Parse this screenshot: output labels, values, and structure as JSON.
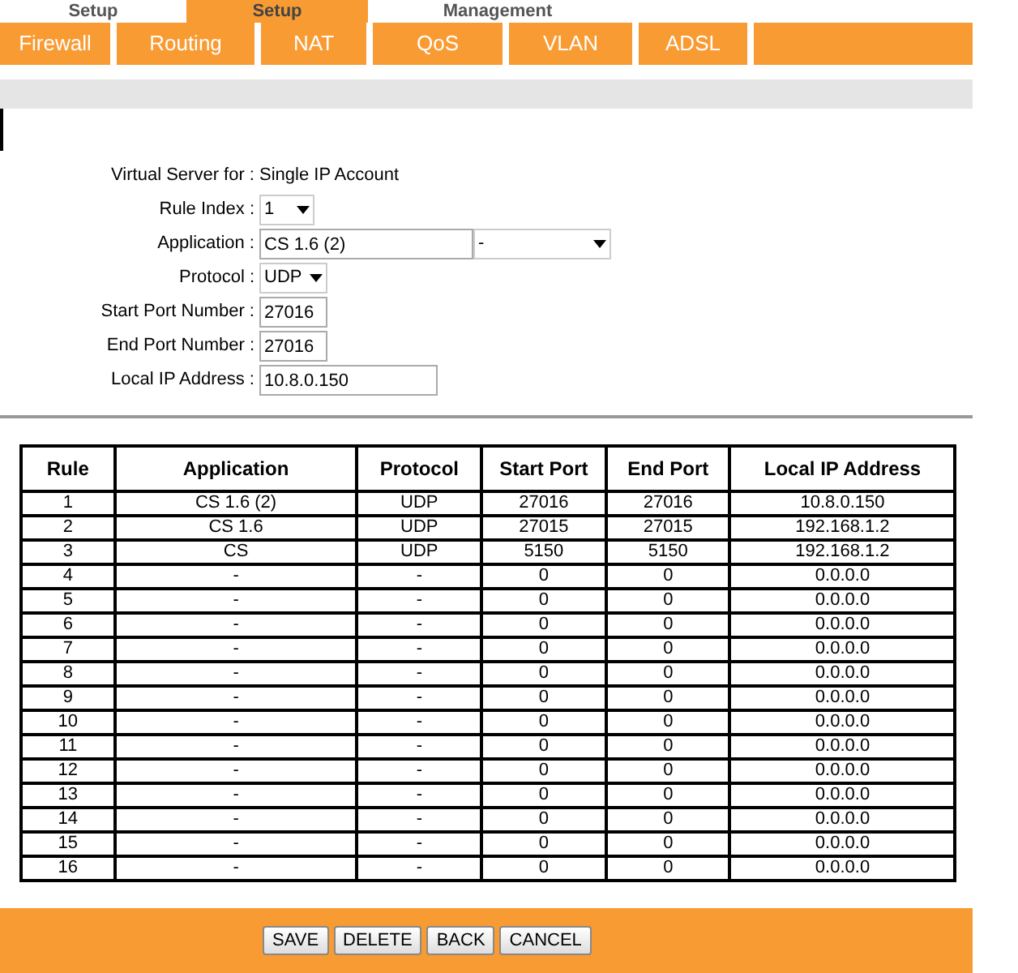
{
  "top_tabs": [
    {
      "label": "Setup",
      "selected": false
    },
    {
      "label": "Setup",
      "selected": true
    },
    {
      "label": "Management",
      "selected": false
    }
  ],
  "sub_tabs": [
    "Firewall",
    "Routing",
    "NAT",
    "QoS",
    "VLAN",
    "ADSL"
  ],
  "form": {
    "virtual_server_label": "Virtual Server for :",
    "virtual_server_value": "Single IP Account",
    "rule_index_label": "Rule Index :",
    "rule_index": "1",
    "application_label": "Application :",
    "application": "CS 1.6 (2)",
    "application_preset": "-",
    "protocol_label": "Protocol :",
    "protocol": "UDP",
    "start_port_label": "Start Port Number :",
    "start_port": "27016",
    "end_port_label": "End Port Number :",
    "end_port": "27016",
    "local_ip_label": "Local IP Address :",
    "local_ip": "10.8.0.150"
  },
  "table": {
    "columns": [
      "Rule",
      "Application",
      "Protocol",
      "Start Port",
      "End Port",
      "Local IP Address"
    ],
    "rows": [
      [
        "1",
        "CS 1.6 (2)",
        "UDP",
        "27016",
        "27016",
        "10.8.0.150"
      ],
      [
        "2",
        "CS 1.6",
        "UDP",
        "27015",
        "27015",
        "192.168.1.2"
      ],
      [
        "3",
        "CS",
        "UDP",
        "5150",
        "5150",
        "192.168.1.2"
      ],
      [
        "4",
        "-",
        "-",
        "0",
        "0",
        "0.0.0.0"
      ],
      [
        "5",
        "-",
        "-",
        "0",
        "0",
        "0.0.0.0"
      ],
      [
        "6",
        "-",
        "-",
        "0",
        "0",
        "0.0.0.0"
      ],
      [
        "7",
        "-",
        "-",
        "0",
        "0",
        "0.0.0.0"
      ],
      [
        "8",
        "-",
        "-",
        "0",
        "0",
        "0.0.0.0"
      ],
      [
        "9",
        "-",
        "-",
        "0",
        "0",
        "0.0.0.0"
      ],
      [
        "10",
        "-",
        "-",
        "0",
        "0",
        "0.0.0.0"
      ],
      [
        "11",
        "-",
        "-",
        "0",
        "0",
        "0.0.0.0"
      ],
      [
        "12",
        "-",
        "-",
        "0",
        "0",
        "0.0.0.0"
      ],
      [
        "13",
        "-",
        "-",
        "0",
        "0",
        "0.0.0.0"
      ],
      [
        "14",
        "-",
        "-",
        "0",
        "0",
        "0.0.0.0"
      ],
      [
        "15",
        "-",
        "-",
        "0",
        "0",
        "0.0.0.0"
      ],
      [
        "16",
        "-",
        "-",
        "0",
        "0",
        "0.0.0.0"
      ]
    ]
  },
  "buttons": [
    "SAVE",
    "DELETE",
    "BACK",
    "CANCEL"
  ]
}
